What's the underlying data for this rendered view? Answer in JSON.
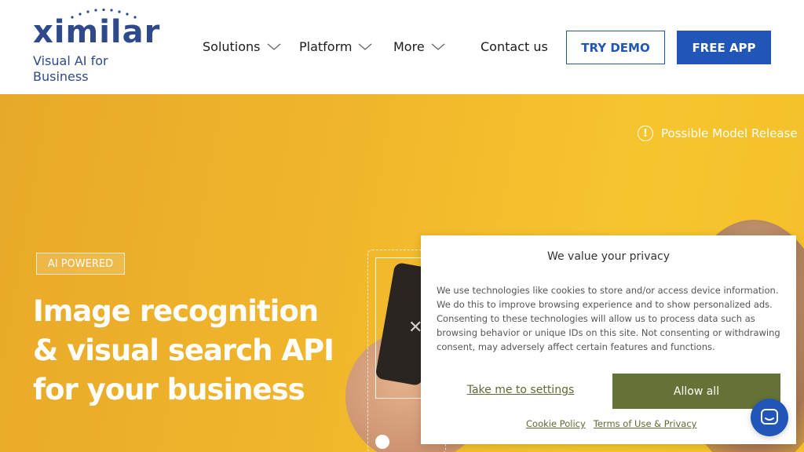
{
  "brand": {
    "logo_text": "ximilar",
    "tagline": "Visual AI for Business",
    "color": "#2e4a8c"
  },
  "nav": {
    "items": [
      {
        "label": "Solutions",
        "has_dropdown": true,
        "icon": "chevron-down-icon"
      },
      {
        "label": "Platform",
        "has_dropdown": true,
        "icon": "chevron-down-icon"
      },
      {
        "label": "More",
        "has_dropdown": true,
        "icon": "chevron-down-icon"
      },
      {
        "label": "Contact us",
        "has_dropdown": false
      }
    ],
    "try_demo_label": "TRY DEMO",
    "free_app_label": "FREE APP",
    "accent_color": "#1f56b8"
  },
  "hero": {
    "badge": "AI POWERED",
    "headline_lines": [
      "Image recognition",
      "& visual search API",
      "for your business"
    ],
    "warning": "Possible Model Release",
    "warning_icon": "alert-circle-icon",
    "background_color": "#f0b52b"
  },
  "cookie": {
    "title": "We value your privacy",
    "body": "We use technologies like cookies to store and/or access device information. We do this to improve browsing experience and to show personalized ads. Consenting to these technologies will allow us to process data such as browsing behavior or unique IDs on this site. Not consenting or withdrawing consent, may adversely affect certain features and functions.",
    "settings_label": "Take me to settings",
    "allow_label": "Allow all",
    "links": [
      "Cookie Policy",
      "Terms of Use & Privacy"
    ],
    "accent_color": "#657236"
  },
  "chat": {
    "icon": "chat-bubble-icon"
  }
}
